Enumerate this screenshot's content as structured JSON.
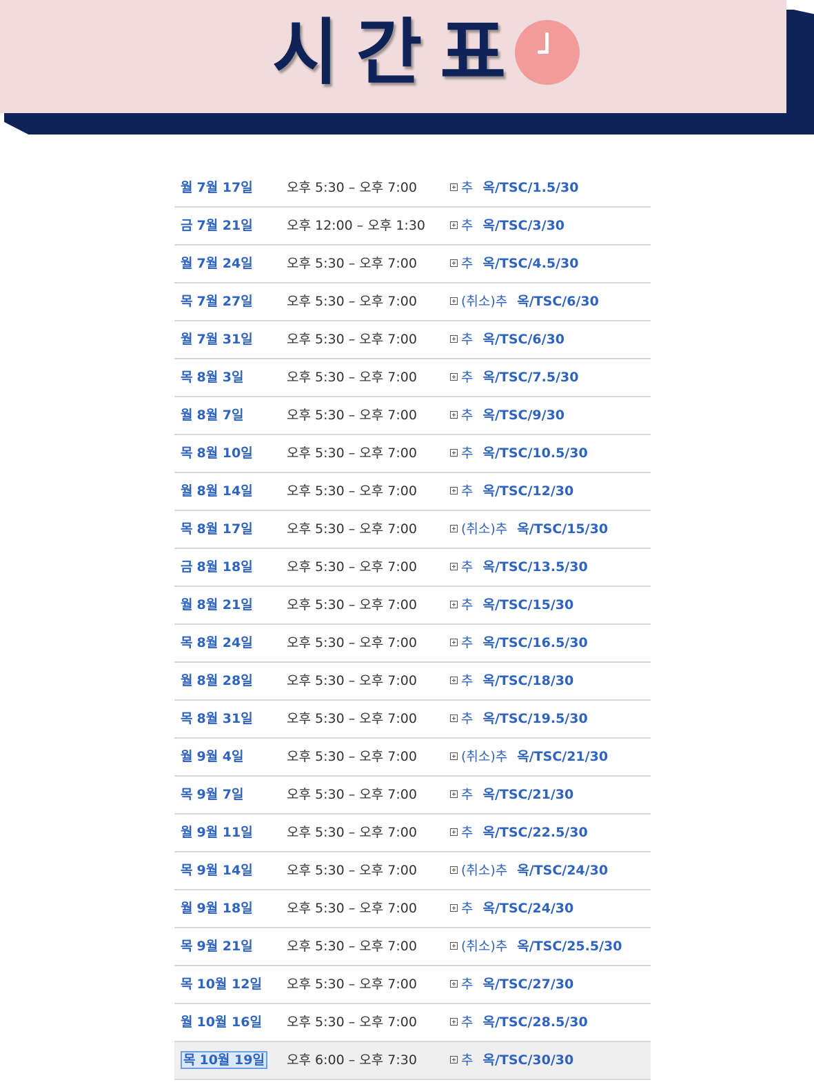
{
  "header": {
    "title": "시간표",
    "icon": "clock-icon",
    "colors": {
      "banner_bg": "#f0dcdc",
      "banner_dark": "#0f2359",
      "clock": "#f29b9b",
      "link": "#2f63c0"
    }
  },
  "schedule": [
    {
      "dow": "월",
      "date": "7월 17일",
      "time": "오후 5:30 – 오후 7:00",
      "state": "추",
      "event": "옥/TSC/1.5/30"
    },
    {
      "dow": "금",
      "date": "7월 21일",
      "time": "오후 12:00 – 오후 1:30",
      "state": "추",
      "event": "옥/TSC/3/30"
    },
    {
      "dow": "월",
      "date": "7월 24일",
      "time": "오후 5:30 – 오후 7:00",
      "state": "추",
      "event": "옥/TSC/4.5/30"
    },
    {
      "dow": "목",
      "date": "7월 27일",
      "time": "오후 5:30 – 오후 7:00",
      "state": "(취소)추",
      "event": "옥/TSC/6/30"
    },
    {
      "dow": "월",
      "date": "7월 31일",
      "time": "오후 5:30 – 오후 7:00",
      "state": "추",
      "event": "옥/TSC/6/30"
    },
    {
      "dow": "목",
      "date": "8월 3일",
      "time": "오후 5:30 – 오후 7:00",
      "state": "추",
      "event": "옥/TSC/7.5/30"
    },
    {
      "dow": "월",
      "date": "8월 7일",
      "time": "오후 5:30 – 오후 7:00",
      "state": "추",
      "event": "옥/TSC/9/30"
    },
    {
      "dow": "목",
      "date": "8월 10일",
      "time": "오후 5:30 – 오후 7:00",
      "state": "추",
      "event": "옥/TSC/10.5/30"
    },
    {
      "dow": "월",
      "date": "8월 14일",
      "time": "오후 5:30 – 오후 7:00",
      "state": "추",
      "event": "옥/TSC/12/30"
    },
    {
      "dow": "목",
      "date": "8월 17일",
      "time": "오후 5:30 – 오후 7:00",
      "state": "(취소)추",
      "event": "옥/TSC/15/30"
    },
    {
      "dow": "금",
      "date": "8월 18일",
      "time": "오후 5:30 – 오후 7:00",
      "state": "추",
      "event": "옥/TSC/13.5/30"
    },
    {
      "dow": "월",
      "date": "8월 21일",
      "time": "오후 5:30 – 오후 7:00",
      "state": "추",
      "event": "옥/TSC/15/30"
    },
    {
      "dow": "목",
      "date": "8월 24일",
      "time": "오후 5:30 – 오후 7:00",
      "state": "추",
      "event": "옥/TSC/16.5/30"
    },
    {
      "dow": "월",
      "date": "8월 28일",
      "time": "오후 5:30 – 오후 7:00",
      "state": "추",
      "event": "옥/TSC/18/30"
    },
    {
      "dow": "목",
      "date": "8월 31일",
      "time": "오후 5:30 – 오후 7:00",
      "state": "추",
      "event": "옥/TSC/19.5/30"
    },
    {
      "dow": "월",
      "date": "9월 4일",
      "time": "오후 5:30 – 오후 7:00",
      "state": "(취소)추",
      "event": "옥/TSC/21/30"
    },
    {
      "dow": "목",
      "date": "9월 7일",
      "time": "오후 5:30 – 오후 7:00",
      "state": "추",
      "event": "옥/TSC/21/30"
    },
    {
      "dow": "월",
      "date": "9월 11일",
      "time": "오후 5:30 – 오후 7:00",
      "state": "추",
      "event": "옥/TSC/22.5/30"
    },
    {
      "dow": "목",
      "date": "9월 14일",
      "time": "오후 5:30 – 오후 7:00",
      "state": "(취소)추",
      "event": "옥/TSC/24/30"
    },
    {
      "dow": "월",
      "date": "9월 18일",
      "time": "오후 5:30 – 오후 7:00",
      "state": "추",
      "event": "옥/TSC/24/30"
    },
    {
      "dow": "목",
      "date": "9월 21일",
      "time": "오후 5:30 – 오후 7:00",
      "state": "(취소)추",
      "event": "옥/TSC/25.5/30"
    },
    {
      "dow": "목",
      "date": "10월 12일",
      "time": "오후 5:30 – 오후 7:00",
      "state": "추",
      "event": "옥/TSC/27/30"
    },
    {
      "dow": "월",
      "date": "10월 16일",
      "time": "오후 5:30 – 오후 7:00",
      "state": "추",
      "event": "옥/TSC/28.5/30"
    },
    {
      "dow": "목",
      "date": "10월 19일",
      "time": "오후 6:00 – 오후 7:30",
      "state": "추",
      "event": "옥/TSC/30/30",
      "selected": true
    }
  ]
}
